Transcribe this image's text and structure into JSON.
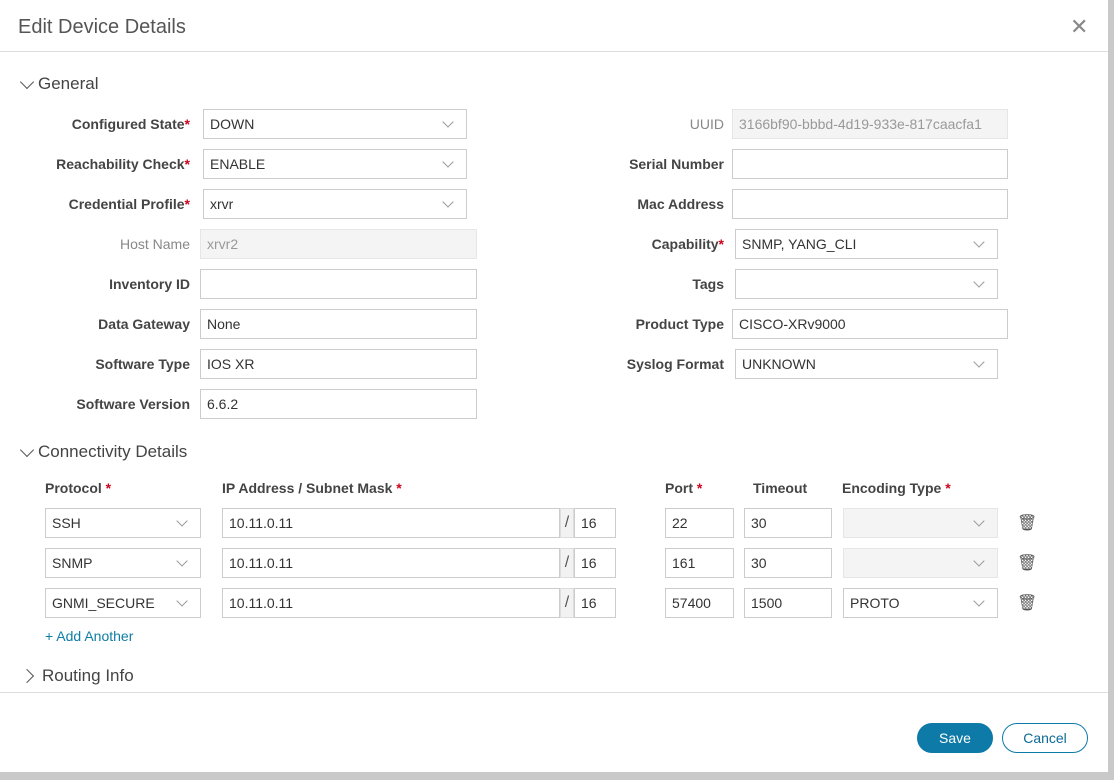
{
  "dialog": {
    "title": "Edit Device Details",
    "close_icon": "close-icon"
  },
  "sections": {
    "general": "General",
    "connectivity": "Connectivity Details",
    "routing": "Routing Info"
  },
  "general_left": [
    {
      "label": "Configured State",
      "required": true,
      "type": "select",
      "value": "DOWN"
    },
    {
      "label": "Reachability Check",
      "required": true,
      "type": "select",
      "value": "ENABLE"
    },
    {
      "label": "Credential Profile",
      "required": true,
      "type": "select",
      "value": "xrvr"
    },
    {
      "label": "Host Name",
      "required": false,
      "type": "disabled",
      "value": "xrvr2"
    },
    {
      "label": "Inventory ID",
      "required": false,
      "type": "input",
      "value": ""
    },
    {
      "label": "Data Gateway",
      "required": false,
      "type": "input",
      "value": "None"
    },
    {
      "label": "Software Type",
      "required": false,
      "type": "input",
      "value": "IOS XR"
    },
    {
      "label": "Software Version",
      "required": false,
      "type": "input",
      "value": "6.6.2"
    }
  ],
  "general_right": [
    {
      "label": "UUID",
      "required": false,
      "type": "disabled",
      "value": "3166bf90-bbbd-4d19-933e-817caacfa1"
    },
    {
      "label": "Serial Number",
      "required": false,
      "type": "input",
      "value": ""
    },
    {
      "label": "Mac Address",
      "required": false,
      "type": "input",
      "value": ""
    },
    {
      "label": "Capability",
      "required": true,
      "type": "select",
      "value": "SNMP, YANG_CLI"
    },
    {
      "label": "Tags",
      "required": false,
      "type": "select",
      "value": ""
    },
    {
      "label": "Product Type",
      "required": false,
      "type": "input",
      "value": "CISCO-XRv9000"
    },
    {
      "label": "Syslog Format",
      "required": false,
      "type": "select",
      "value": "UNKNOWN"
    }
  ],
  "connectivity": {
    "headers": {
      "protocol": "Protocol",
      "ip": "IP Address / Subnet Mask",
      "port": "Port",
      "timeout": "Timeout",
      "encoding": "Encoding Type",
      "req": "*"
    },
    "slash": "/",
    "rows": [
      {
        "protocol": "SSH",
        "ip": "10.11.0.11",
        "mask": "16",
        "port": "22",
        "timeout": "30",
        "encoding": "",
        "encoding_disabled": true
      },
      {
        "protocol": "SNMP",
        "ip": "10.11.0.11",
        "mask": "16",
        "port": "161",
        "timeout": "30",
        "encoding": "",
        "encoding_disabled": true
      },
      {
        "protocol": "GNMI_SECURE",
        "ip": "10.11.0.11",
        "mask": "16",
        "port": "57400",
        "timeout": "1500",
        "encoding": "PROTO",
        "encoding_disabled": false
      }
    ],
    "add_another": "+ Add Another"
  },
  "footer": {
    "save": "Save",
    "cancel": "Cancel"
  },
  "colors": {
    "primary": "#0d7aa8",
    "required": "#d0021b"
  }
}
